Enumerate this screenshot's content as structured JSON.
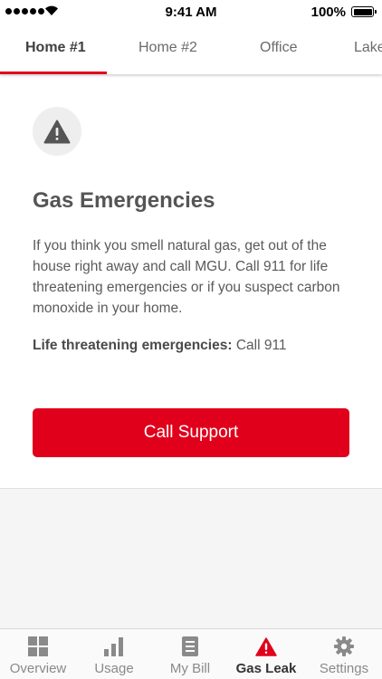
{
  "status_bar": {
    "time": "9:41 AM",
    "battery": "100%"
  },
  "tabs": [
    {
      "label": "Home #1",
      "active": true
    },
    {
      "label": "Home #2",
      "active": false
    },
    {
      "label": "Office",
      "active": false
    },
    {
      "label": "Lake",
      "active": false
    }
  ],
  "card": {
    "icon": "warning-icon",
    "title": "Gas Emergencies",
    "body": "If you think you smell natural gas, get out of the house right away and call MGU. Call 911 for life threatening emergencies or if you suspect carbon monoxide in your home.",
    "emergency_label": "Life threatening emergencies:",
    "emergency_value": "Call 911",
    "button_label": "Call Support"
  },
  "bottom_nav": [
    {
      "label": "Overview",
      "icon": "grid-icon",
      "active": false
    },
    {
      "label": "Usage",
      "icon": "bar-chart-icon",
      "active": false
    },
    {
      "label": "My Bill",
      "icon": "bill-icon",
      "active": false
    },
    {
      "label": "Gas Leak",
      "icon": "warning-icon",
      "active": true
    },
    {
      "label": "Settings",
      "icon": "gear-icon",
      "active": false
    }
  ],
  "colors": {
    "accent": "#e0001b",
    "text": "#5a5a5a",
    "background": "#f5f5f5"
  }
}
